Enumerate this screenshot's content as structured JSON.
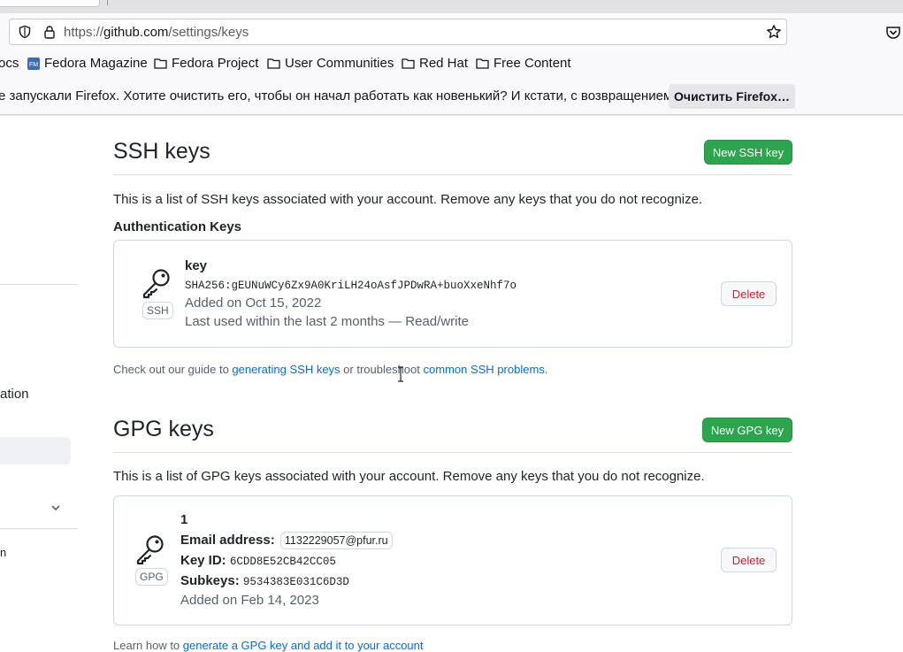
{
  "browser": {
    "url_prefix": "https://",
    "url_host": "github.com",
    "url_path": "/settings/keys"
  },
  "bookmarks": [
    {
      "label": "ocs"
    },
    {
      "label": "Fedora Magazine"
    },
    {
      "label": "Fedora Project"
    },
    {
      "label": "User Communities"
    },
    {
      "label": "Red Hat"
    },
    {
      "label": "Free Content"
    }
  ],
  "notification": {
    "text": "е запускали Firefox. Хотите очистить его, чтобы он начал работать как новенький? И кстати, с возвращением!",
    "button_label": "Очистить Firefox…"
  },
  "sidebar": {
    "partial_item_1": "ation",
    "partial_item_2": "n"
  },
  "ssh": {
    "title": "SSH keys",
    "new_button": "New SSH key",
    "description": "This is a list of SSH keys associated with your account. Remove any keys that you do not recognize.",
    "subheading": "Authentication Keys",
    "keys": [
      {
        "name": "key",
        "badge": "SSH",
        "fingerprint": "SHA256:gEUNuWCy6Zx9A0KriLH24oAsfJPDwRA+buoXxeNhf7o",
        "added": "Added on Oct 15, 2022",
        "last_used": "Last used within the last 2 months — Read/write",
        "delete_label": "Delete"
      }
    ],
    "note": {
      "prefix": "Check out our guide to ",
      "link1": "generating SSH keys",
      "middle": " or troubleshoot ",
      "link2": "common SSH problems",
      "suffix": "."
    }
  },
  "gpg": {
    "title": "GPG keys",
    "new_button": "New GPG key",
    "description": "This is a list of GPG keys associated with your account. Remove any keys that you do not recognize.",
    "keys": [
      {
        "name": "1",
        "badge": "GPG",
        "email_label": "Email address:",
        "email": "1132229057@pfur.ru",
        "keyid_label": "Key ID:",
        "keyid": "6CDD8E52CB42CC05",
        "subkeys_label": "Subkeys:",
        "subkeys": "9534383E031C6D3D",
        "added": "Added on Feb 14, 2023",
        "delete_label": "Delete"
      }
    ],
    "note": {
      "prefix": "Learn how to ",
      "link": "generate a GPG key and add it to your account"
    }
  }
}
